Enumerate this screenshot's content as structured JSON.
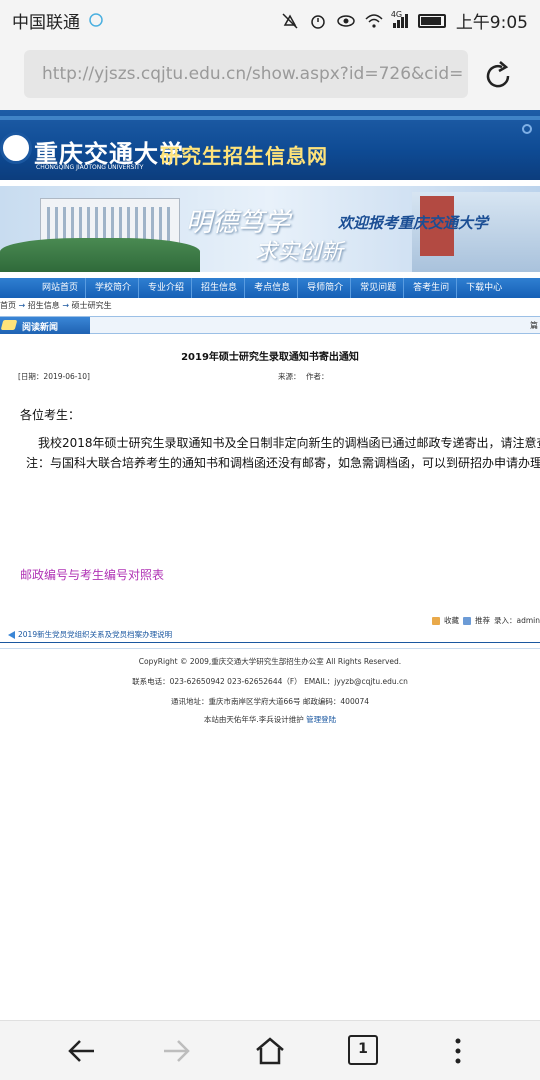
{
  "status_bar": {
    "carrier": "中国联通",
    "network": "4G",
    "time": "上午9:05",
    "icons": [
      "notification-mute-icon",
      "alarm-icon",
      "eye-icon",
      "wifi-icon",
      "signal-icon",
      "battery-icon"
    ]
  },
  "browser": {
    "url": "http://yjszs.cqjtu.edu.cn/show.aspx?id=726&cid=",
    "bottom_tabs_count": "1"
  },
  "site": {
    "logo_name": "重庆交通大学",
    "logo_sub": "CHONGQING JIAOTONG UNIVERSITY",
    "title": "研究生招生信息网",
    "motto_1": "明德笃学",
    "motto_2": "求实创新",
    "welcome": "欢迎报考重庆交通大学"
  },
  "nav": {
    "items": [
      "网站首页",
      "学校简介",
      "专业介绍",
      "招生信息",
      "考点信息",
      "导师简介",
      "常见问题",
      "答考生问",
      "下载中心"
    ]
  },
  "breadcrumb": {
    "items": [
      "首页",
      "招生信息",
      "硕士研究生"
    ],
    "sep": "→"
  },
  "section": {
    "tab_label": "阅读新闻",
    "right_text": "篇"
  },
  "article": {
    "title": "2019年硕士研究生录取通知书寄出通知",
    "date": "[日期：2019-06-10]",
    "source_label": "来源：",
    "author_label": "作者：",
    "greeting": "各位考生：",
    "para1": "我校2018年硕士研究生录取通知书及全日制非定向新生的调档函已通过邮政专递寄出，请注意查",
    "para2": "注：与国科大联合培养考生的通知书和调档函还没有邮寄，如急需调档函，可以到研招办申请办理",
    "attachment": "邮政编号与考生编号对照表"
  },
  "tools": {
    "favorite": "收藏",
    "recommend": "推荐",
    "entry": "录入：admin"
  },
  "prev_link": "2019新生党员党组织关系及党员档案办理说明",
  "footer": {
    "copyright": "CopyRight © 2009,重庆交通大学研究生部招生办公室 All Rights Reserved.",
    "contact": "联系电话：023-62650942 023-62652644（F） EMAIL：jyyzb@cqjtu.edu.cn",
    "address": "通讯地址：重庆市南岸区学府大道66号 邮政编码：400074",
    "maintain": "本站由天佑年华.李兵设计维护",
    "admin_login": "管理登陆"
  }
}
